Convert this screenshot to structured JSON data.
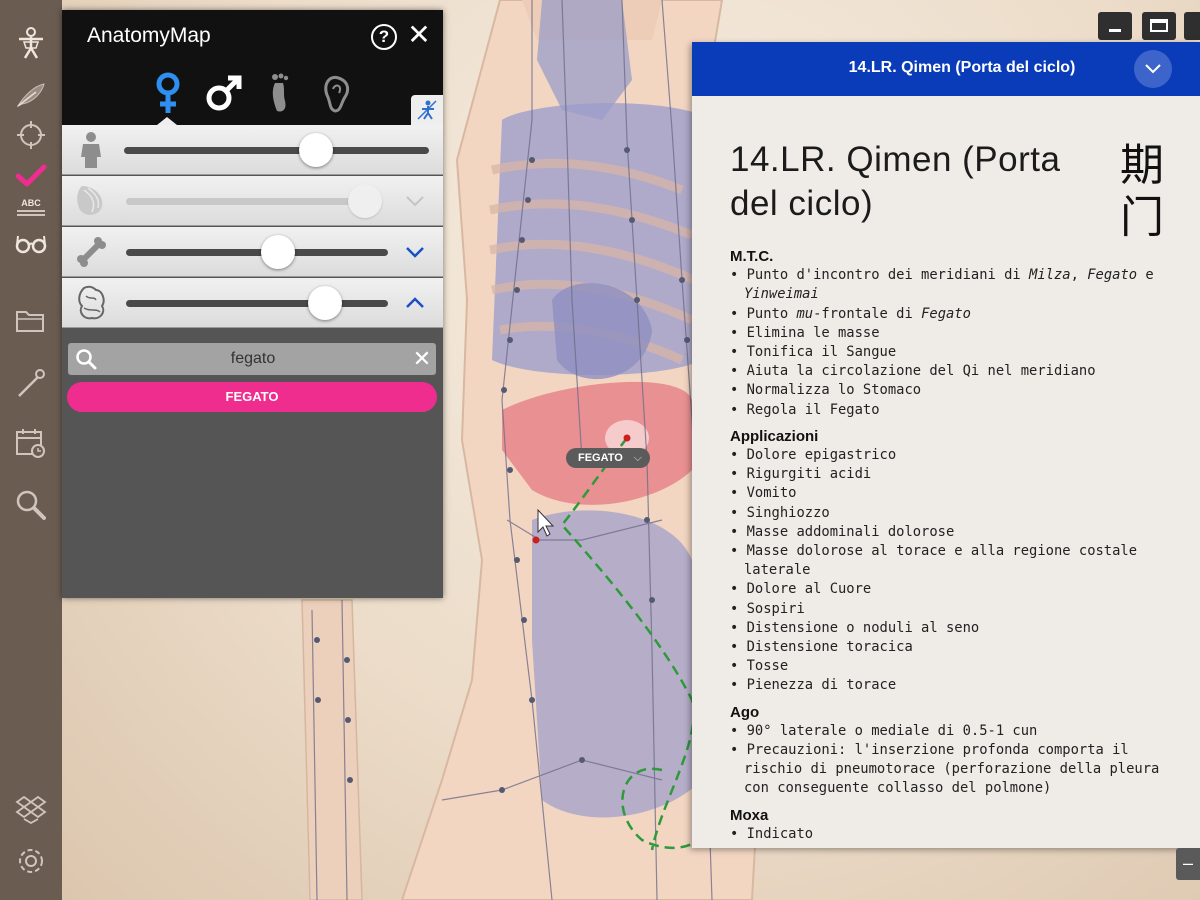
{
  "app": {
    "title": "AnatomyMap",
    "help_label": "?",
    "close_label": "✕"
  },
  "toolbar": {
    "items": [
      {
        "name": "anatomy-figure-icon"
      },
      {
        "name": "feather-icon"
      },
      {
        "name": "target-icon"
      },
      {
        "name": "checkmark-icon",
        "color": "#ee2d8f"
      },
      {
        "name": "abc-label-icon",
        "label": "ABC"
      },
      {
        "name": "glasses-icon"
      },
      {
        "name": "folder-icon"
      },
      {
        "name": "needle-icon"
      },
      {
        "name": "calendar-icon"
      },
      {
        "name": "magnifier-icon"
      },
      {
        "name": "dropbox-icon"
      },
      {
        "name": "settings-icon"
      }
    ]
  },
  "model_tabs": [
    {
      "name": "female-tab",
      "icon": "female-symbol-icon",
      "selected": true,
      "color": "#2e8ff0"
    },
    {
      "name": "male-tab",
      "icon": "male-symbol-icon",
      "selected": false
    },
    {
      "name": "foot-tab",
      "icon": "foot-icon",
      "selected": false
    },
    {
      "name": "ear-tab",
      "icon": "ear-icon",
      "selected": false
    }
  ],
  "layers": [
    {
      "name": "skin",
      "icon": "body-silhouette-icon",
      "level": 0.63,
      "enabled": true,
      "chevron": "none"
    },
    {
      "name": "muscles",
      "icon": "muscle-icon",
      "level": 0.98,
      "enabled": false,
      "chevron": "down"
    },
    {
      "name": "skeleton",
      "icon": "bone-icon",
      "level": 0.58,
      "enabled": true,
      "chevron": "down"
    },
    {
      "name": "organs",
      "icon": "organs-icon",
      "level": 0.76,
      "enabled": true,
      "chevron": "up"
    }
  ],
  "search": {
    "value": "fegato",
    "clear_label": "✕",
    "results": [
      "FEGATO"
    ]
  },
  "viewport": {
    "organ_label": "FEGATO",
    "label_chevron": "⌵"
  },
  "window_controls": [
    "minimize",
    "restore",
    "close"
  ],
  "info_panel": {
    "header_title": "14.LR. Qimen (Porta del ciclo)",
    "title": "14.LR. Qimen (Porta del ciclo)",
    "chinese": "期门",
    "sections": [
      {
        "title": "M.T.C.",
        "items": [
          "Punto d'incontro dei meridiani di Milza, Fegato e Yinweimai",
          "Punto mu-frontale di Fegato",
          "Elimina le masse",
          "Tonifica il Sangue",
          "Aiuta la circolazione del Qi nel meridiano",
          "Normalizza lo Stomaco",
          "Regola il Fegato"
        ]
      },
      {
        "title": "Applicazioni",
        "items": [
          "Dolore epigastrico",
          "Rigurgiti acidi",
          "Vomito",
          "Singhiozzo",
          "Masse addominali dolorose",
          "Masse dolorose al torace e alla regione costale laterale",
          "Dolore al Cuore",
          "Sospiri",
          "Distensione o noduli al seno",
          "Distensione toracica",
          "Tosse",
          "Pienezza di torace"
        ]
      },
      {
        "title": "Ago",
        "items": [
          "90° laterale o mediale di 0.5-1 cun",
          "Precauzioni: l'inserzione profonda comporta il rischio di pneumotorace (perforazione della pleura con conseguente collasso del polmone)"
        ]
      },
      {
        "title": "Moxa",
        "items": [
          "Indicato"
        ]
      }
    ],
    "resize_label": "–"
  },
  "colors": {
    "accent_pink": "#ee2d8f",
    "header_blue": "#0a3bb8",
    "female_blue": "#2e8ff0"
  }
}
